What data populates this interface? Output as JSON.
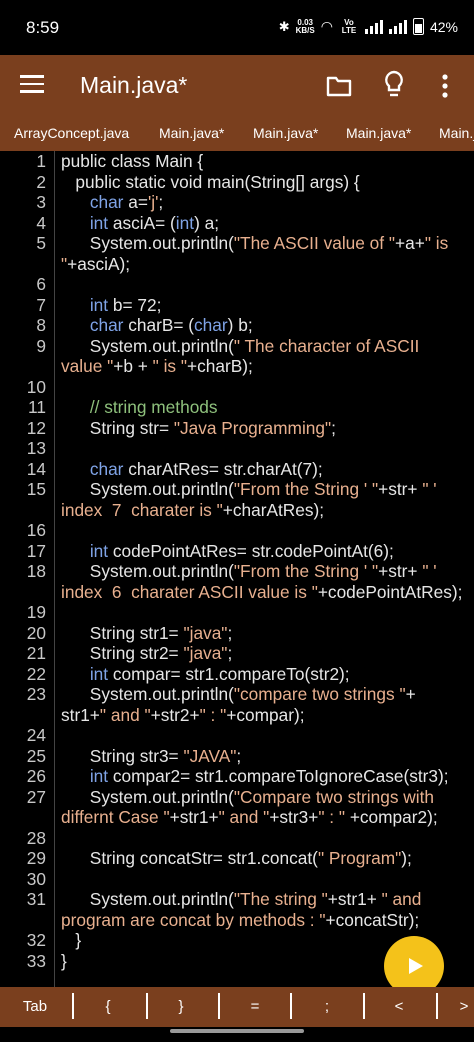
{
  "status": {
    "time": "8:59",
    "net_speed": "0.03",
    "net_unit": "KB/S",
    "volte": "Vo LTE",
    "battery": "42%"
  },
  "appbar": {
    "title": "Main.java*",
    "icons": [
      "menu-icon",
      "folder-icon",
      "lightbulb-icon",
      "more-vert-icon"
    ]
  },
  "tabs": [
    "ArrayConcept.java",
    "Main.java*",
    "Main.java*",
    "Main.java*",
    "Main.j"
  ],
  "code_lines": [
    {
      "n": "1",
      "t": [
        [
          "public class Main {",
          ""
        ]
      ]
    },
    {
      "n": "2",
      "t": [
        [
          "   public static void main(String[] args) {",
          ""
        ]
      ]
    },
    {
      "n": "3",
      "t": [
        [
          "      ",
          ""
        ],
        [
          "char",
          "kw"
        ],
        [
          " a=",
          ""
        ],
        [
          "'j'",
          "str"
        ],
        [
          ";",
          ""
        ]
      ]
    },
    {
      "n": "4",
      "t": [
        [
          "      ",
          ""
        ],
        [
          "int",
          "kw"
        ],
        [
          " asciA= (",
          ""
        ],
        [
          "int",
          "kw"
        ],
        [
          ") a;",
          ""
        ]
      ]
    },
    {
      "n": "5",
      "t": [
        [
          "      System.out.println(",
          ""
        ],
        [
          "\"The ASCII value of \"",
          "str"
        ],
        [
          "+a+",
          ""
        ],
        [
          "\" is",
          "str"
        ]
      ]
    },
    {
      "n": "",
      "t": [
        [
          "\"",
          "str"
        ],
        [
          "+asciA);",
          ""
        ]
      ]
    },
    {
      "n": "6",
      "t": []
    },
    {
      "n": "7",
      "t": [
        [
          "      ",
          ""
        ],
        [
          "int",
          "kw"
        ],
        [
          " b= 72;",
          ""
        ]
      ]
    },
    {
      "n": "8",
      "t": [
        [
          "      ",
          ""
        ],
        [
          "char",
          "kw"
        ],
        [
          " charB= (",
          ""
        ],
        [
          "char",
          "kw"
        ],
        [
          ") b;",
          ""
        ]
      ]
    },
    {
      "n": "9",
      "t": [
        [
          "      System.out.println(",
          ""
        ],
        [
          "\" The character of ASCII",
          "str"
        ]
      ]
    },
    {
      "n": "",
      "t": [
        [
          "value \"",
          "str"
        ],
        [
          "+b + ",
          ""
        ],
        [
          "\" is \"",
          "str"
        ],
        [
          "+charB);",
          ""
        ]
      ]
    },
    {
      "n": "10",
      "t": []
    },
    {
      "n": "11",
      "t": [
        [
          "      ",
          ""
        ],
        [
          "// string methods",
          "cmt"
        ]
      ]
    },
    {
      "n": "12",
      "t": [
        [
          "      String str= ",
          ""
        ],
        [
          "\"Java Programming\"",
          "str"
        ],
        [
          ";",
          ""
        ]
      ]
    },
    {
      "n": "13",
      "t": []
    },
    {
      "n": "14",
      "t": [
        [
          "      ",
          ""
        ],
        [
          "char",
          "kw"
        ],
        [
          " charAtRes= str.charAt(7);",
          ""
        ]
      ]
    },
    {
      "n": "15",
      "t": [
        [
          "      System.out.println(",
          ""
        ],
        [
          "\"From the String ' \"",
          "str"
        ],
        [
          "+str+ ",
          ""
        ],
        [
          "\" '",
          "str"
        ]
      ]
    },
    {
      "n": "",
      "t": [
        [
          "index  7  charater is \"",
          "str"
        ],
        [
          "+charAtRes);",
          ""
        ]
      ]
    },
    {
      "n": "16",
      "t": []
    },
    {
      "n": "17",
      "t": [
        [
          "      ",
          ""
        ],
        [
          "int",
          "kw"
        ],
        [
          " codePointAtRes= str.codePointAt(6);",
          ""
        ]
      ]
    },
    {
      "n": "18",
      "t": [
        [
          "      System.out.println(",
          ""
        ],
        [
          "\"From the String ' \"",
          "str"
        ],
        [
          "+str+ ",
          ""
        ],
        [
          "\" '",
          "str"
        ]
      ]
    },
    {
      "n": "",
      "t": [
        [
          "index  6  charater ASCII value is \"",
          "str"
        ],
        [
          "+codePointAtRes);",
          ""
        ]
      ]
    },
    {
      "n": "19",
      "t": []
    },
    {
      "n": "20",
      "t": [
        [
          "      String str1= ",
          ""
        ],
        [
          "\"java\"",
          "str"
        ],
        [
          ";",
          ""
        ]
      ]
    },
    {
      "n": "21",
      "t": [
        [
          "      String str2= ",
          ""
        ],
        [
          "\"java\"",
          "str"
        ],
        [
          ";",
          ""
        ]
      ]
    },
    {
      "n": "22",
      "t": [
        [
          "      ",
          ""
        ],
        [
          "int",
          "kw"
        ],
        [
          " compar= str1.compareTo(str2);",
          ""
        ]
      ]
    },
    {
      "n": "23",
      "t": [
        [
          "      System.out.println(",
          ""
        ],
        [
          "\"compare two strings \"",
          "str"
        ],
        [
          "+",
          ""
        ]
      ]
    },
    {
      "n": "",
      "t": [
        [
          "str1+",
          ""
        ],
        [
          "\" and \"",
          "str"
        ],
        [
          "+str2+",
          ""
        ],
        [
          "\" : \"",
          "str"
        ],
        [
          "+compar);",
          ""
        ]
      ]
    },
    {
      "n": "24",
      "t": []
    },
    {
      "n": "25",
      "t": [
        [
          "      String str3= ",
          ""
        ],
        [
          "\"JAVA\"",
          "str"
        ],
        [
          ";",
          ""
        ]
      ]
    },
    {
      "n": "26",
      "t": [
        [
          "      ",
          ""
        ],
        [
          "int",
          "kw"
        ],
        [
          " compar2= str1.compareToIgnoreCase(str3);",
          ""
        ]
      ]
    },
    {
      "n": "27",
      "t": [
        [
          "      System.out.println(",
          ""
        ],
        [
          "\"Compare two strings with",
          "str"
        ]
      ]
    },
    {
      "n": "",
      "t": [
        [
          "differnt Case \"",
          "str"
        ],
        [
          "+str1+",
          ""
        ],
        [
          "\" and \"",
          "str"
        ],
        [
          "+str3+",
          ""
        ],
        [
          "\" : \"",
          "str"
        ],
        [
          " +compar2);",
          ""
        ]
      ]
    },
    {
      "n": "28",
      "t": []
    },
    {
      "n": "29",
      "t": [
        [
          "      String concatStr= str1.concat(",
          ""
        ],
        [
          "\" Program\"",
          "str"
        ],
        [
          ");",
          ""
        ]
      ]
    },
    {
      "n": "30",
      "t": []
    },
    {
      "n": "31",
      "t": [
        [
          "      System.out.println(",
          ""
        ],
        [
          "\"The string \"",
          "str"
        ],
        [
          "+str1+ ",
          ""
        ],
        [
          "\" and",
          "str"
        ]
      ]
    },
    {
      "n": "",
      "t": [
        [
          "program are concat by methods : \"",
          "str"
        ],
        [
          "+concatStr);",
          ""
        ]
      ]
    },
    {
      "n": "32",
      "t": [
        [
          "   }",
          ""
        ]
      ]
    },
    {
      "n": "33",
      "t": [
        [
          "}",
          ""
        ]
      ]
    }
  ],
  "keys": [
    "Tab",
    "{",
    "}",
    "=",
    ";",
    "<",
    ">"
  ],
  "colors": {
    "appbar": "#7a3f1e",
    "keyword": "#7fa3e6",
    "string": "#e8b08f",
    "comment": "#8ec07c",
    "fab": "#f4c21a"
  }
}
